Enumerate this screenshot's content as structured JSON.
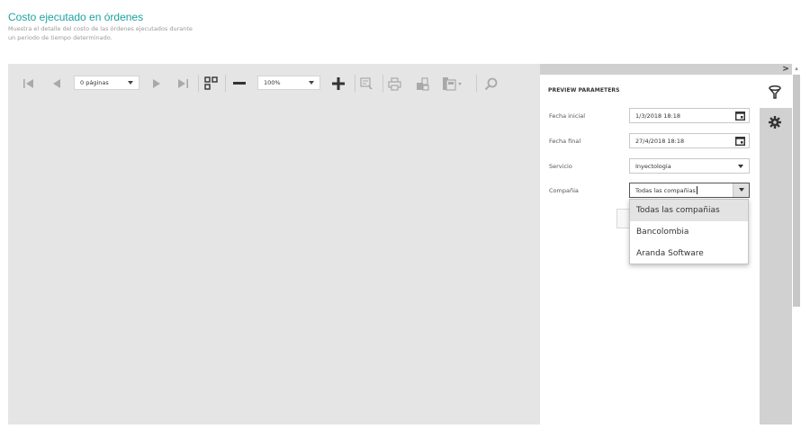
{
  "header": {
    "title": "Costo ejecutado en órdenes",
    "subtitle": "Muestra el detalle del costo de las órdenes ejecutados durante un periodo de tiempo determinado."
  },
  "toolbar": {
    "page_select": "0 páginas",
    "zoom_select": "100%",
    "icons": [
      "first-page-icon",
      "previous-page-icon",
      "next-page-icon",
      "last-page-icon",
      "multipage-icon",
      "zoom-out-icon",
      "zoom-in-icon",
      "highlight-icon",
      "print-icon",
      "print-page-icon",
      "export-icon",
      "search-icon"
    ]
  },
  "parameters": {
    "heading": "PREVIEW PARAMETERS",
    "fields": [
      {
        "label": "Fecha inicial",
        "value": "1/3/2018 18:18"
      },
      {
        "label": "Fecha final",
        "value": "27/4/2018 18:18"
      },
      {
        "label": "Servicio",
        "value": "Inyectologia"
      },
      {
        "label": "Compañia",
        "value": "Todas las compañias"
      }
    ],
    "dropdown_options": [
      "Todas las compañias",
      "Bancolombia",
      "Aranda Software"
    ],
    "selected_index": 0
  },
  "sidebar": {
    "collapse_label": ">",
    "icons": [
      "filter-icon",
      "gear-icon"
    ]
  },
  "colors": {
    "accent": "#1ba3a0",
    "viewer_bg": "#e5e5e5",
    "sidebar_bg": "#d1d1d1"
  }
}
